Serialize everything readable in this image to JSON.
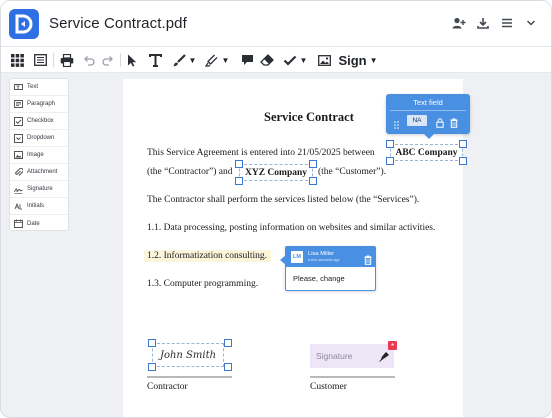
{
  "window": {
    "title": "Service Contract.pdf"
  },
  "titlebar_icons": [
    "add-user-icon",
    "download-icon",
    "menu-icon",
    "chevron-down-icon"
  ],
  "toolbar": {
    "tools": [
      "thumbnails-grid",
      "list-view",
      "print",
      "undo",
      "redo",
      "select-cursor",
      "text",
      "draw-brush",
      "highlighter",
      "comment",
      "eraser",
      "checkmark",
      "image"
    ],
    "sign_label": "Sign"
  },
  "palette": {
    "items": [
      {
        "label": "Text",
        "icon": "text-field-icon"
      },
      {
        "label": "Paragraph",
        "icon": "paragraph-icon"
      },
      {
        "label": "Checkbox",
        "icon": "checkbox-icon"
      },
      {
        "label": "Dropdown",
        "icon": "dropdown-icon"
      },
      {
        "label": "Image",
        "icon": "image-icon"
      },
      {
        "label": "Attachment",
        "icon": "attachment-icon"
      },
      {
        "label": "Signature",
        "icon": "signature-icon"
      },
      {
        "label": "Initials",
        "icon": "initials-icon"
      },
      {
        "label": "Date",
        "icon": "date-icon"
      }
    ]
  },
  "document": {
    "heading": "Service Contract",
    "para1_start": "This Service Agreement is entered into 21/05/2025 between",
    "party1": "ABC Company",
    "para2_start": "(the “Contractor”) and",
    "party2": "XYZ Company",
    "para2_end": "(the “Customer”).",
    "para3": "The Contractor shall perform the services listed below (the “Services”).",
    "item1": "1.1. Data processing, posting information on websites and similar activities.",
    "item2": "1.2. Informatization consulting.",
    "item3": "1.3. Computer programming.",
    "signer1_name": "John Smith",
    "signer1_role": "Contractor",
    "signer2_role": "Customer",
    "signature_placeholder": "Signature"
  },
  "text_field_popover": {
    "title": "Text field",
    "badge": "NA"
  },
  "comment": {
    "avatar": "LM",
    "author": "Lisa Miller",
    "time": "a few seconds ago",
    "body": "Please, change"
  },
  "colors": {
    "accent": "#4a90e2",
    "brand": "#2f6fe4",
    "highlight": "#fbf5dc",
    "signature_field": "#ece6f7",
    "required": "#ea3b52"
  }
}
